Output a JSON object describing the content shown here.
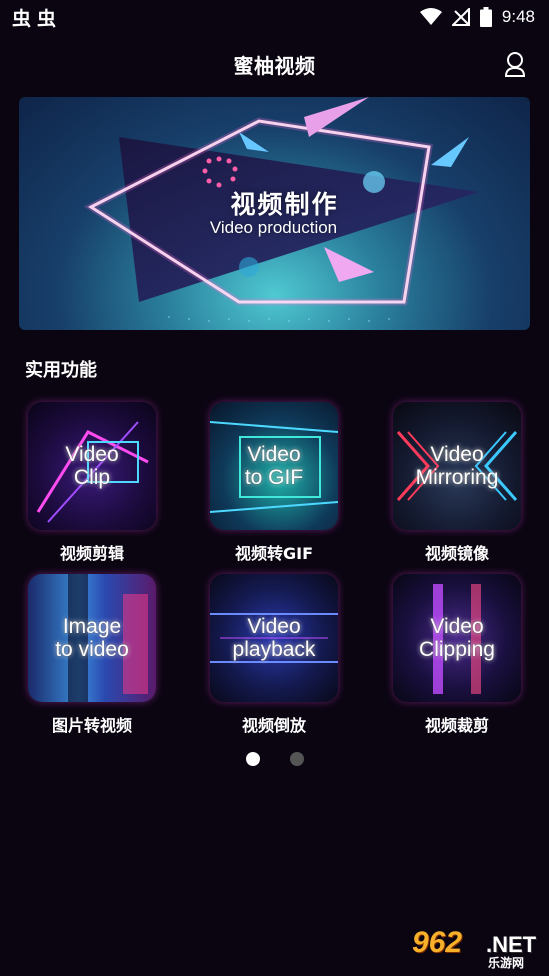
{
  "status_bar": {
    "left_icons": [
      "bug-icon",
      "bug-icon"
    ],
    "left_glyph": "虫",
    "time": "9:48"
  },
  "header": {
    "title": "蜜柚视频",
    "profile_icon": "user-profile-icon"
  },
  "banner": {
    "title": "视频制作",
    "subtitle": "Video production"
  },
  "section": {
    "title": "实用功能"
  },
  "features": [
    {
      "thumb_text": "Video\nClip",
      "label": "视频剪辑",
      "accent": "#b04cff"
    },
    {
      "thumb_text": "Video\nto GIF",
      "label": "视频转GIF",
      "accent": "#2fd4c8"
    },
    {
      "thumb_text": "Video\nMirroring",
      "label": "视频镜像",
      "accent": "#ff3a5a"
    },
    {
      "thumb_text": "Image\nto video",
      "label": "图片转视频",
      "accent": "#4aa8ff"
    },
    {
      "thumb_text": "Video\nplayback",
      "label": "视频倒放",
      "accent": "#3c6cff"
    },
    {
      "thumb_text": "Video\nClipping",
      "label": "视频裁剪",
      "accent": "#c04cff"
    }
  ],
  "pager": {
    "pages": 2,
    "active_index": 0,
    "active_color": "#ffffff",
    "inactive_color": "#555555"
  },
  "watermark": {
    "number": "962",
    "net": ".NET",
    "site": "乐游网"
  },
  "colors": {
    "background": "#0b0512"
  }
}
